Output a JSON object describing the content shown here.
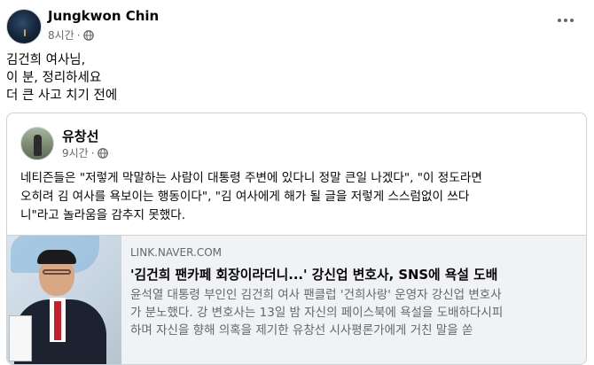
{
  "post": {
    "author": "Jungkwon Chin",
    "time": "8시간",
    "separator": "·",
    "privacy_icon": "globe-icon",
    "more_icon": "more-horizontal-icon",
    "text_lines": [
      "김건희 여사님,",
      "이 분, 정리하세요",
      "더 큰 사고 치기 전에"
    ]
  },
  "shared": {
    "author": "유창선",
    "time": "9시간",
    "separator": "·",
    "privacy_icon": "globe-icon",
    "text_lines": [
      "네티즌들은 \"저렇게 막말하는 사람이 대통령 주변에 있다니 정말 큰일 나겠다\", \"이 정도라면",
      "오히려 김 여사를 욕보이는 행동이다\", \"김 여사에게 해가 될 글을 저렇게 스스럼없이 쓰다",
      "니\"라고 놀라움을 감추지 못했다."
    ],
    "link": {
      "domain": "LINK.NAVER.COM",
      "title": "'김건희 팬카페 회장이라더니...' 강신업 변호사, SNS에 욕설 도배",
      "desc_lines": [
        "윤석열 대통령 부인인 김건희 여사 팬클럽 '건희사랑' 운영자 강신업 변호사",
        "가 분노했다. 강 변호사는 13일 밤 자신의 페이스북에 욕설을 도배하다시피",
        "하며 자신을 향해 의혹을 제기한 유창선 시사평론가에게 거친 말을 쏟"
      ]
    }
  },
  "colors": {
    "name": "#050505",
    "meta": "#65676b",
    "card_border": "#ced0d4",
    "preview_bg": "#f0f2f5"
  }
}
